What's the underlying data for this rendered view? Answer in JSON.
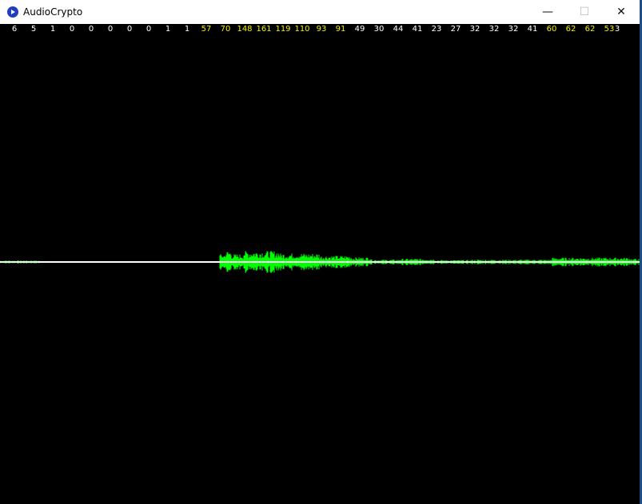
{
  "window": {
    "title": "AudioCrypto",
    "controls": {
      "minimize": "—",
      "maximize": "☐",
      "close": "✕"
    }
  },
  "colors": {
    "background": "#000000",
    "count_normal": "#ffffff",
    "count_highlight": "#f0f000",
    "waveform": "#00ff00",
    "baseline": "#ffffff"
  },
  "counts": [
    {
      "value": "6",
      "highlight": false
    },
    {
      "value": "5",
      "highlight": false
    },
    {
      "value": "1",
      "highlight": false
    },
    {
      "value": "0",
      "highlight": false
    },
    {
      "value": "0",
      "highlight": false
    },
    {
      "value": "0",
      "highlight": false
    },
    {
      "value": "0",
      "highlight": false
    },
    {
      "value": "0",
      "highlight": false
    },
    {
      "value": "1",
      "highlight": false
    },
    {
      "value": "1",
      "highlight": false
    },
    {
      "value": "57",
      "highlight": true
    },
    {
      "value": "70",
      "highlight": true
    },
    {
      "value": "148",
      "highlight": true
    },
    {
      "value": "161",
      "highlight": true
    },
    {
      "value": "119",
      "highlight": true
    },
    {
      "value": "110",
      "highlight": true
    },
    {
      "value": "93",
      "highlight": true
    },
    {
      "value": "91",
      "highlight": true
    },
    {
      "value": "49",
      "highlight": false
    },
    {
      "value": "30",
      "highlight": false
    },
    {
      "value": "44",
      "highlight": false
    },
    {
      "value": "41",
      "highlight": false
    },
    {
      "value": "23",
      "highlight": false
    },
    {
      "value": "27",
      "highlight": false
    },
    {
      "value": "32",
      "highlight": false
    },
    {
      "value": "32",
      "highlight": false
    },
    {
      "value": "32",
      "highlight": false
    },
    {
      "value": "41",
      "highlight": false
    },
    {
      "value": "60",
      "highlight": true
    },
    {
      "value": "62",
      "highlight": true
    },
    {
      "value": "62",
      "highlight": true
    },
    {
      "value": "53",
      "highlight": true
    },
    {
      "value": "3",
      "highlight": false
    }
  ]
}
